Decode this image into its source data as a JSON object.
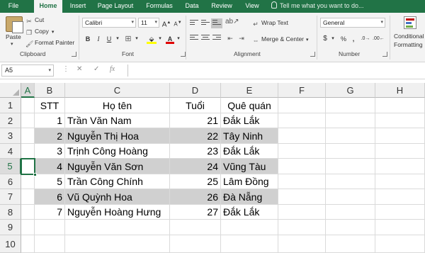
{
  "ribbon_tabs": [
    "File",
    "Home",
    "Insert",
    "Page Layout",
    "Formulas",
    "Data",
    "Review",
    "View"
  ],
  "tell_me": "Tell me what you want to do...",
  "clipboard": {
    "paste": "Paste",
    "cut": "Cut",
    "copy": "Copy",
    "format_painter": "Format Painter",
    "label": "Clipboard"
  },
  "font": {
    "name": "Calibri",
    "size": "11",
    "label": "Font"
  },
  "alignment": {
    "wrap_text": "Wrap Text",
    "merge_center": "Merge & Center",
    "label": "Alignment"
  },
  "number": {
    "format": "General",
    "label": "Number"
  },
  "styles": {
    "conditional_formatting": "Conditional",
    "conditional_formatting_2": "Formatting"
  },
  "formula_bar": {
    "name_box": "A5",
    "fx": "fx",
    "formula": ""
  },
  "columns": [
    "A",
    "B",
    "C",
    "D",
    "E",
    "F",
    "G",
    "H"
  ],
  "rows": [
    "1",
    "2",
    "3",
    "4",
    "5",
    "6",
    "7",
    "8",
    "9",
    "10"
  ],
  "active_cell": "A5",
  "table": {
    "headers": {
      "stt": "STT",
      "name": "Họ tên",
      "age": "Tuổi",
      "hometown": "Quê quán"
    },
    "rows": [
      {
        "stt": "1",
        "name": "Trần Văn Nam",
        "age": "21",
        "hometown": "Đắk Lắk"
      },
      {
        "stt": "2",
        "name": "Nguyễn Thị Hoa",
        "age": "22",
        "hometown": "Tây Ninh"
      },
      {
        "stt": "3",
        "name": "Trịnh Công Hoàng",
        "age": "23",
        "hometown": "Đắk Lắk"
      },
      {
        "stt": "4",
        "name": "Nguyễn Văn Sơn",
        "age": "24",
        "hometown": "Vũng Tàu"
      },
      {
        "stt": "5",
        "name": "Trần Công Chính",
        "age": "25",
        "hometown": "Lâm Đồng"
      },
      {
        "stt": "6",
        "name": "Vũ Quỳnh Hoa",
        "age": "26",
        "hometown": "Đà Nẵng"
      },
      {
        "stt": "7",
        "name": "Nguyễn Hoàng Hưng",
        "age": "27",
        "hometown": "Đắk Lắk"
      }
    ]
  },
  "colors": {
    "accent": "#217346",
    "shaded_row": "#d0d0d0"
  }
}
